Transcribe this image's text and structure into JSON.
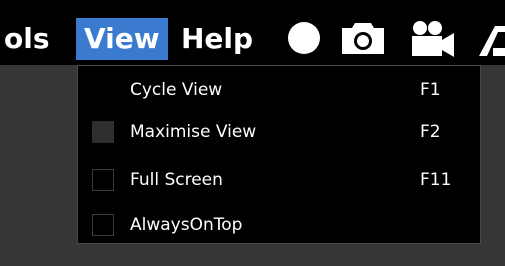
{
  "menubar": {
    "items": [
      {
        "label": "ols"
      },
      {
        "label": "View"
      },
      {
        "label": "Help"
      }
    ],
    "icons": [
      "record-circle-icon",
      "camera-icon",
      "video-camera-icon",
      "cut-icon"
    ]
  },
  "view_menu": {
    "items": [
      {
        "label": "Cycle View",
        "shortcut": "F1",
        "checkbox": "none"
      },
      {
        "label": "Maximise View",
        "shortcut": "F2",
        "checkbox": "filled"
      },
      {
        "label": "Full Screen",
        "shortcut": "F11",
        "checkbox": "unchecked"
      },
      {
        "label": "AlwaysOnTop",
        "shortcut": "",
        "checkbox": "unchecked"
      }
    ]
  },
  "colors": {
    "menubar_bg": "#000000",
    "active_menu_bg": "#3a7bd0",
    "dropdown_bg": "#000000",
    "window_bg": "#363636",
    "text": "#ffffff"
  }
}
